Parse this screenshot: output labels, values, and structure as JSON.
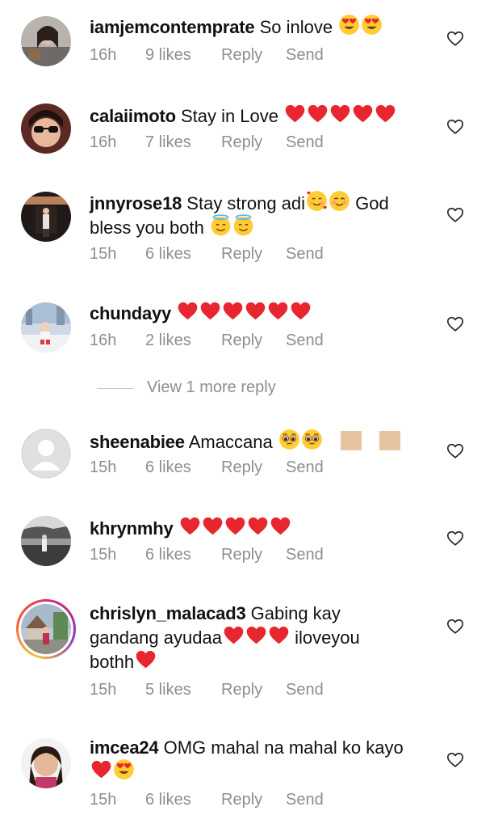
{
  "comments": [
    {
      "username": "iamjemcontemprate",
      "text": "So inlove",
      "emojis": [
        "heart-eyes",
        "heart-eyes"
      ],
      "time": "16h",
      "likes": "9 likes",
      "reply": "Reply",
      "send": "Send"
    },
    {
      "username": "calaiimoto",
      "text": "Stay in Love",
      "emojis": [
        "red-heart",
        "red-heart",
        "red-heart",
        "red-heart",
        "red-heart"
      ],
      "time": "16h",
      "likes": "7 likes",
      "reply": "Reply",
      "send": "Send"
    },
    {
      "username": "jnnyrose18",
      "text": "Stay strong adi",
      "text2": "God",
      "text3": "bless you both",
      "emojis": [
        "smiling-hearts",
        "smiling-blush"
      ],
      "emojis2": [
        "halo",
        "halo"
      ],
      "time": "15h",
      "likes": "6 likes",
      "reply": "Reply",
      "send": "Send"
    },
    {
      "username": "chundayy",
      "text": "",
      "emojis": [
        "red-heart",
        "red-heart",
        "red-heart",
        "red-heart",
        "red-heart",
        "red-heart"
      ],
      "time": "16h",
      "likes": "2 likes",
      "reply": "Reply",
      "send": "Send"
    },
    {
      "username": "sheenabiee",
      "text": "Amaccana",
      "emojis": [
        "pleading",
        "pleading"
      ],
      "thumbs": 2,
      "time": "15h",
      "likes": "6 likes",
      "reply": "Reply",
      "send": "Send"
    },
    {
      "username": "khrynmhy",
      "text": "",
      "emojis": [
        "red-heart",
        "red-heart",
        "red-heart",
        "red-heart",
        "red-heart"
      ],
      "time": "15h",
      "likes": "6 likes",
      "reply": "Reply",
      "send": "Send"
    },
    {
      "username": "chrislyn_malacad3",
      "text": "Gabing kay",
      "text2": "gandang ayudaa",
      "text3": "iloveyou",
      "text4": "bothh",
      "emojis": [
        "red-heart",
        "red-heart",
        "red-heart"
      ],
      "emojis2": [
        "red-heart"
      ],
      "time": "15h",
      "likes": "5 likes",
      "reply": "Reply",
      "send": "Send"
    },
    {
      "username": "imcea24",
      "text": "OMG mahal na mahal ko kayo",
      "emojis": [
        "red-heart",
        "heart-eyes"
      ],
      "time": "15h",
      "likes": "6 likes",
      "reply": "Reply",
      "send": "Send"
    }
  ],
  "view_more": "View 1 more reply",
  "icons": {
    "like": "heart-outline-icon"
  },
  "colors": {
    "meta": "#8e8e8e",
    "heart": "#e8262f",
    "emoji_face": "#ffcc33"
  }
}
